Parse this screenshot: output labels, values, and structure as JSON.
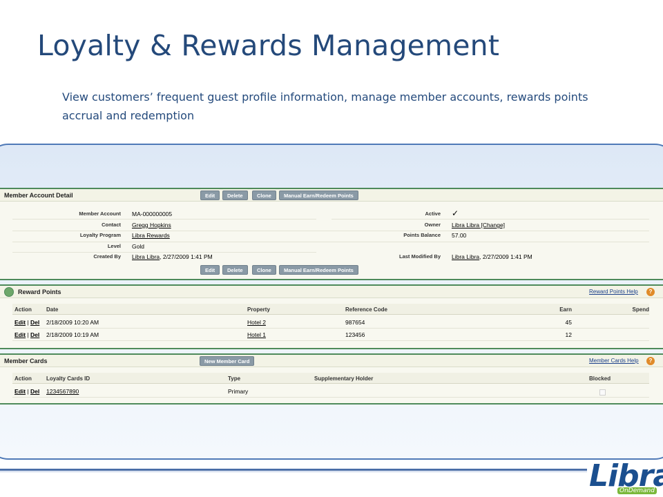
{
  "slide": {
    "title": "Loyalty & Rewards Management",
    "subtitle": "View customers’ frequent guest profile information, manage member accounts, rewards points accrual and redemption"
  },
  "member_account": {
    "header": "Member Account Detail",
    "buttons": [
      "Edit",
      "Delete",
      "Clone",
      "Manual Earn/Redeem Points"
    ],
    "fields_left": [
      {
        "label": "Member Account",
        "value": "MA-000000005"
      },
      {
        "label": "Contact",
        "value": "Gregg Hopkins"
      },
      {
        "label": "Loyalty Program",
        "value": "Libra Rewards"
      },
      {
        "label": "Level",
        "value": "Gold"
      },
      {
        "label": "Created By",
        "value_link": "Libra Libra",
        "value_rest": ", 2/27/2009 1:41 PM"
      }
    ],
    "fields_right": [
      {
        "label": "Active",
        "value": "✓"
      },
      {
        "label": "Owner",
        "value_link": "Libra Libra",
        "value_rest": " [Change]"
      },
      {
        "label": "Points Balance",
        "value": "57.00"
      },
      {
        "label": "Last Modified By",
        "value_link": "Libra Libra",
        "value_rest": ", 2/27/2009 1:41 PM"
      }
    ]
  },
  "reward_points": {
    "header": "Reward Points",
    "help": "Reward Points Help",
    "help_icon": "?",
    "columns": [
      "Action",
      "Date",
      "Property",
      "Reference Code",
      "Earn",
      "Spend"
    ],
    "rows": [
      {
        "edit": "Edit",
        "sep": "|",
        "del": "Del",
        "date": "2/18/2009 10:20 AM",
        "property": "Hotel 2",
        "ref": "987654",
        "earn": "45",
        "spend": ""
      },
      {
        "edit": "Edit",
        "sep": "|",
        "del": "Del",
        "date": "2/18/2009 10:19 AM",
        "property": "Hotel 1",
        "ref": "123456",
        "earn": "12",
        "spend": ""
      }
    ]
  },
  "member_cards": {
    "header": "Member Cards",
    "new_button": "New Member Card",
    "help": "Member Cards Help",
    "help_icon": "?",
    "columns": [
      "Action",
      "Loyalty Cards ID",
      "Type",
      "Supplementary Holder",
      "Blocked"
    ],
    "rows": [
      {
        "edit": "Edit",
        "sep": "|",
        "del": "Del",
        "card_id": "1234567890",
        "type": "Primary",
        "supplementary": "",
        "blocked": false
      }
    ]
  },
  "logo": {
    "name": "Libra",
    "tagline": "OnDemand"
  },
  "colors": {
    "title": "#24497a",
    "accent_green": "#4e8a5a",
    "frame": "#4f79b7"
  }
}
